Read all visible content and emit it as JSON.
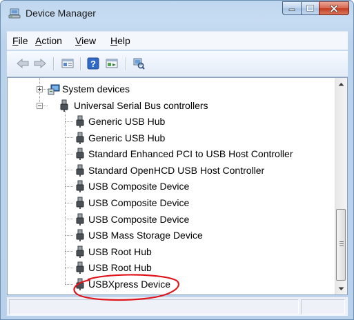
{
  "window": {
    "title": "Device Manager",
    "icon": "device-manager-icon"
  },
  "menu": [
    {
      "label": "File",
      "u": "F",
      "rest": "ile"
    },
    {
      "label": "Action",
      "u": "A",
      "rest": "ction"
    },
    {
      "label": "View",
      "u": "V",
      "rest": "iew"
    },
    {
      "label": "Help",
      "u": "H",
      "rest": "elp"
    }
  ],
  "toolbar": {
    "icons": [
      "back-arrow-icon",
      "forward-arrow-icon",
      "properties-icon",
      "help-icon",
      "show-hide-icon",
      "scan-hardware-icon"
    ]
  },
  "tree": {
    "categories": [
      {
        "label": "System devices",
        "expanded": false,
        "icon": "system-devices-icon"
      },
      {
        "label": "Universal Serial Bus controllers",
        "expanded": true,
        "icon": "usb-plug-icon"
      }
    ],
    "usb_devices": [
      "Generic USB Hub",
      "Generic USB Hub",
      "Standard Enhanced PCI to USB Host Controller",
      "Standard OpenHCD USB Host Controller",
      "USB Composite Device",
      "USB Composite Device",
      "USB Composite Device",
      "USB Mass Storage Device",
      "USB Root Hub",
      "USB Root Hub",
      "USBXpress Device"
    ],
    "circled_device": "USBXpress Device"
  },
  "colors": {
    "annotation_circle": "#e0141b",
    "window_frame": "#bfd7ef",
    "close_button": "#c33b1f"
  }
}
